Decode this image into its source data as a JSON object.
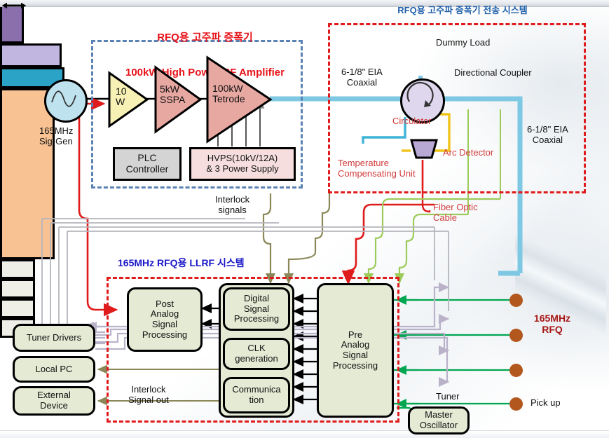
{
  "diagram": {
    "titles": {
      "amplifier_kr": "RFQ용 고주파 증폭기",
      "amplifier_en": "100kW High Power RF Amplifier",
      "transmission_kr": "RFQ용 고주파 증폭기 전송 시스템",
      "llrf_kr": "165MHz RFQ용 LLRF 시스템"
    },
    "amplifier_section": {
      "signal_generator": "165MHz\nSig-Gen",
      "amp1": "10\nW",
      "amp2": "5kW\nSSPA",
      "amp3": "100kW\nTetrode",
      "plc": "PLC\nController",
      "hvps": "HVPS(10kV/12A)\n& 3 Power Supply"
    },
    "transmission_section": {
      "coax_left": "6-1/8\" EIA\nCoaxial",
      "coax_right": "6-1/8\" EIA\nCoaxial",
      "dummy_load": "Dummy Load",
      "circulator": "Circulator",
      "directional_coupler": "Directional Coupler",
      "temperature_unit": "Temperature\nCompensating Unit",
      "arc_detector": "Arc Detector"
    },
    "llrf_section": {
      "post_analog": "Post\nAnalog\nSignal\nProcessing",
      "digital": "Digital\nSignal\nProcessing",
      "clk": "CLK\ngeneration",
      "comm": "Communica\ntion",
      "pre_analog": "Pre\nAnalog\nSignal\nProcessing",
      "master_oscillator": "Master\nOscillator"
    },
    "left_devices": [
      {
        "label": "Tuner Drivers"
      },
      {
        "label": "Local PC"
      },
      {
        "label": "External\nDevice"
      }
    ],
    "rfq_section": {
      "label": "165MHz\nRFQ",
      "tuner": "Tuner",
      "pickup": "Pick up"
    },
    "annotations": {
      "interlock_signals": "Interlock\nsignals",
      "fiber_optic": "Fiber Optic\nCable",
      "interlock_out": "Interlock\nSignal out"
    },
    "colors": {
      "title_red": "#e8131a",
      "title_blue": "#1f5fa9",
      "title_navy": "#1a18c8",
      "dash_blue": "#5b82b5",
      "dash_red": "#e01b1b",
      "coax_blue": "#7ec8e3",
      "rfq_orange": "#f8c293",
      "green_block": "#e4ead4",
      "interlock_olive": "#8a8758",
      "fiber_green": "#9ccb5a",
      "red_wire": "#e01b1b",
      "tuner_purple": "#bdb6cd",
      "pickup_green": "#00a651",
      "pickup_dot": "#b2571d"
    }
  }
}
